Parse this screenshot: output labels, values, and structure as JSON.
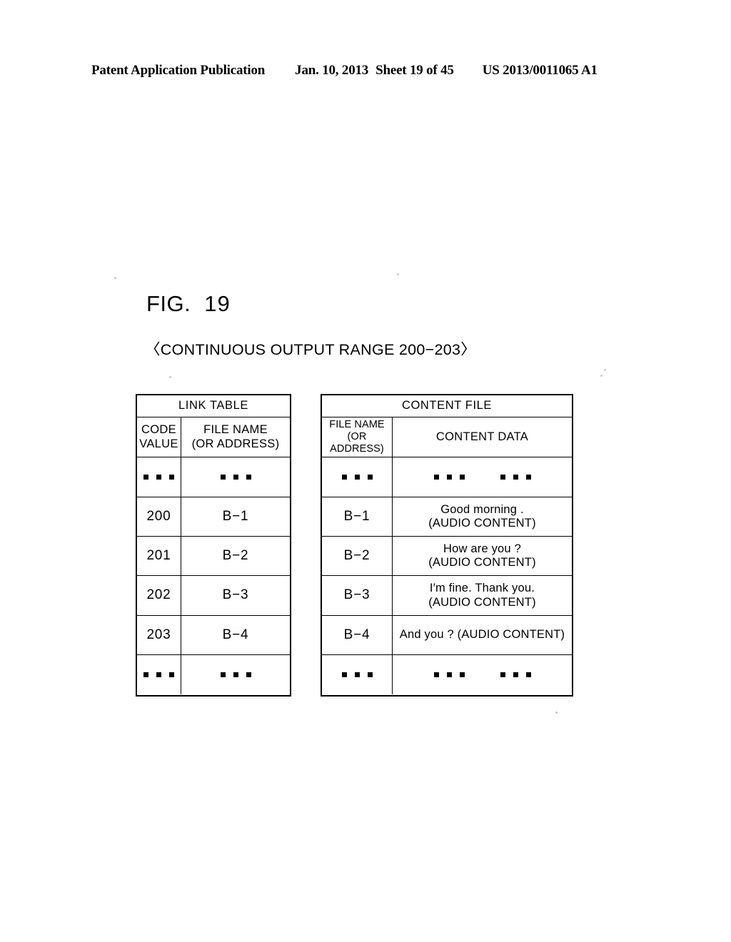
{
  "header": {
    "publication": "Patent Application Publication",
    "date": "Jan. 10, 2013",
    "sheet": "Sheet 19 of 45",
    "patent_number": "US 2013/0011065 A1"
  },
  "figure": {
    "label_word": "FIG.",
    "label_number": "19",
    "caption": "〈CONTINUOUS OUTPUT RANGE 200−203〉"
  },
  "link_table": {
    "title": "LINK TABLE",
    "columns": [
      {
        "header": "CODE VALUE",
        "line1": "CODE",
        "line2": "VALUE"
      },
      {
        "header": "FILE NAME (OR ADDRESS)",
        "line1": "FILE NAME",
        "line2": "(OR ADDRESS)"
      }
    ],
    "rows": [
      {
        "code_value": "▪ ▪ ▪",
        "file_name": "▪ ▪ ▪",
        "is_ellipsis": true
      },
      {
        "code_value": "200",
        "file_name": "B−1",
        "is_ellipsis": false
      },
      {
        "code_value": "201",
        "file_name": "B−2",
        "is_ellipsis": false
      },
      {
        "code_value": "202",
        "file_name": "B−3",
        "is_ellipsis": false
      },
      {
        "code_value": "203",
        "file_name": "B−4",
        "is_ellipsis": false
      },
      {
        "code_value": "▪ ▪ ▪",
        "file_name": "▪ ▪ ▪",
        "is_ellipsis": true
      }
    ]
  },
  "content_file_table": {
    "title": "CONTENT FILE",
    "columns": [
      {
        "header": "FILE NAME (OR ADDRESS)",
        "line1": "FILE NAME",
        "line2": "(OR ADDRESS)"
      },
      {
        "header": "CONTENT DATA"
      }
    ],
    "rows": [
      {
        "file_name": "▪ ▪ ▪",
        "content_line1": "▪ ▪ ▪    ▪ ▪ ▪",
        "content_line2": "",
        "is_ellipsis": true
      },
      {
        "file_name": "B−1",
        "content_line1": "Good morning .",
        "content_line2": "(AUDIO CONTENT)",
        "is_ellipsis": false
      },
      {
        "file_name": "B−2",
        "content_line1": "How are you ?",
        "content_line2": "(AUDIO CONTENT)",
        "is_ellipsis": false
      },
      {
        "file_name": "B−3",
        "content_line1": "I′m fine. Thank you.",
        "content_line2": "(AUDIO CONTENT)",
        "is_ellipsis": false
      },
      {
        "file_name": "B−4",
        "content_line1": "And you ?  (AUDIO CONTENT)",
        "content_line2": "",
        "is_ellipsis": false
      },
      {
        "file_name": "▪ ▪ ▪",
        "content_line1": "▪ ▪ ▪    ▪ ▪ ▪",
        "content_line2": "",
        "is_ellipsis": true
      }
    ]
  },
  "colors": {
    "ink": "#000000",
    "paper": "#ffffff"
  }
}
